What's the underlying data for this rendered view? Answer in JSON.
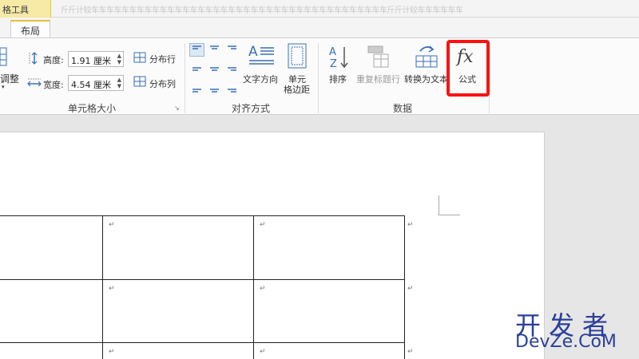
{
  "header": {
    "context_tab": "格工具",
    "doc_title": "斤斤计较车车车车车车车车车车车车车车车车车车车车车车车车车车车车车车车车车车车车车车车斤斤计较车车车车车车"
  },
  "tabs": {
    "active": "布局"
  },
  "ribbon": {
    "cell_size": {
      "autofit_label": "调整",
      "height_label": "高度:",
      "height_value": "1.91 厘米",
      "width_label": "宽度:",
      "width_value": "4.54 厘米",
      "distribute_rows": "分布行",
      "distribute_cols": "分布列",
      "group_label": "单元格大小"
    },
    "alignment": {
      "text_direction": "文字方向",
      "cell_margins_line1": "单元",
      "cell_margins_line2": "格边距",
      "group_label": "对齐方式"
    },
    "data": {
      "sort": "排序",
      "repeat_header": "重复标题行",
      "convert_to_text": "转换为文本",
      "formula": "公式",
      "group_label": "数据"
    }
  },
  "document": {
    "cell_mark": "↵"
  },
  "watermark": {
    "cn": "开发者",
    "en": "DevZe.CoM"
  },
  "colors": {
    "highlight": "#ff1111",
    "context_tab": "#f7e9a6",
    "icon_blue": "#3a6fb5",
    "watermark": "#2a3f9a"
  }
}
